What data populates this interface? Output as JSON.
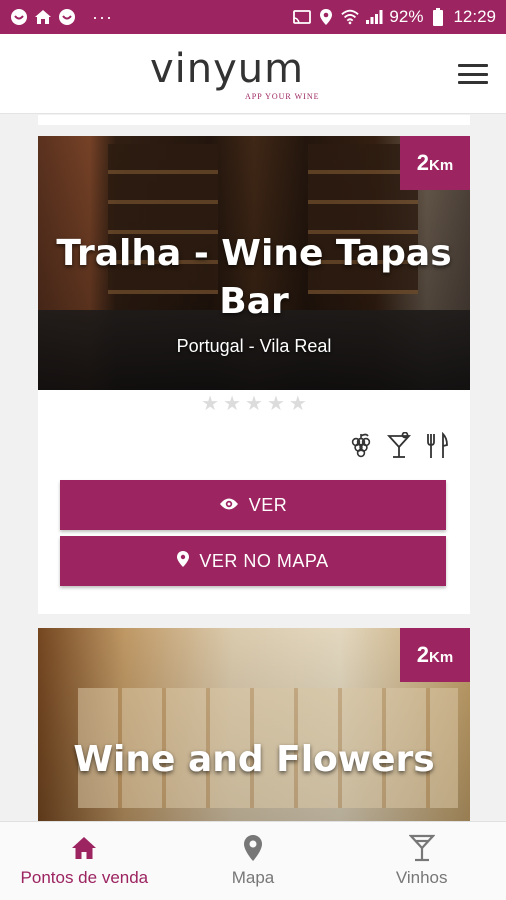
{
  "status_bar": {
    "battery": "92%",
    "time": "12:29",
    "dots": "···"
  },
  "header": {
    "logo_word": "vinyum",
    "logo_tagline": "APP YOUR WINE"
  },
  "venues": [
    {
      "distance_number": "2",
      "distance_unit": "Km",
      "title_line1": "Tralha - Wine Tapas",
      "title_line2": "Bar",
      "location": "Portugal - Vila Real",
      "rating": 0,
      "features": [
        "grapes-icon",
        "cocktail-icon",
        "cutlery-icon"
      ],
      "view_label": "VER",
      "map_label": "VER NO MAPA"
    },
    {
      "distance_number": "2",
      "distance_unit": "Km",
      "title_line1": "Wine and Flowers"
    }
  ],
  "bottom_nav": [
    {
      "label": "Pontos de venda",
      "icon": "home-icon",
      "active": true
    },
    {
      "label": "Mapa",
      "icon": "map-pin-icon",
      "active": false
    },
    {
      "label": "Vinhos",
      "icon": "wine-glass-icon",
      "active": false
    }
  ],
  "colors": {
    "brand": "#9c2460",
    "star_empty": "#dcdcdc",
    "nav_inactive": "#777777"
  }
}
